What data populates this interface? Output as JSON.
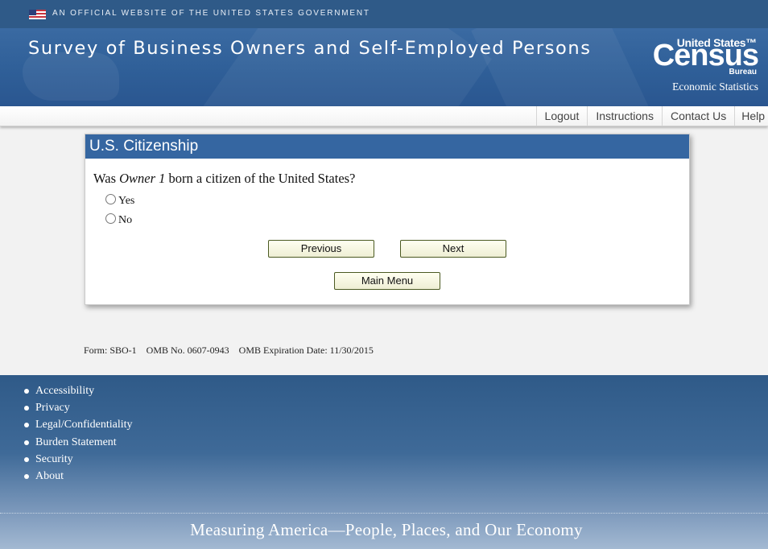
{
  "gov_banner": {
    "text": "AN OFFICIAL WEBSITE OF THE UNITED STATES GOVERNMENT",
    "icon": "us-flag-icon"
  },
  "header": {
    "title": "Survey of Business Owners and Self-Employed Persons",
    "logo": {
      "line1": "United States™",
      "line2": "Census",
      "line3": "Bureau",
      "subtitle": "Economic Statistics"
    }
  },
  "nav": {
    "logout": "Logout",
    "instructions": "Instructions",
    "contact": "Contact Us",
    "help": "Help"
  },
  "panel": {
    "title": "U.S. Citizenship",
    "question_prefix": "Was ",
    "question_owner": "Owner 1",
    "question_suffix": " born a citizen of the United States?",
    "options": {
      "yes": "Yes",
      "no": "No"
    },
    "buttons": {
      "previous": "Previous",
      "next": "Next",
      "main_menu": "Main Menu"
    }
  },
  "form_info": "Form: SBO-1    OMB No. 0607-0943    OMB Expiration Date: 11/30/2015",
  "footer": {
    "links": [
      "Accessibility",
      "Privacy",
      "Legal/Confidentiality",
      "Burden Statement",
      "Security",
      "About"
    ],
    "tagline": "Measuring America—People, Places, and Our Economy"
  },
  "colors": {
    "header_blue": "#2f5a88",
    "panel_head": "#3566a1",
    "button_border": "#4b5a22"
  }
}
